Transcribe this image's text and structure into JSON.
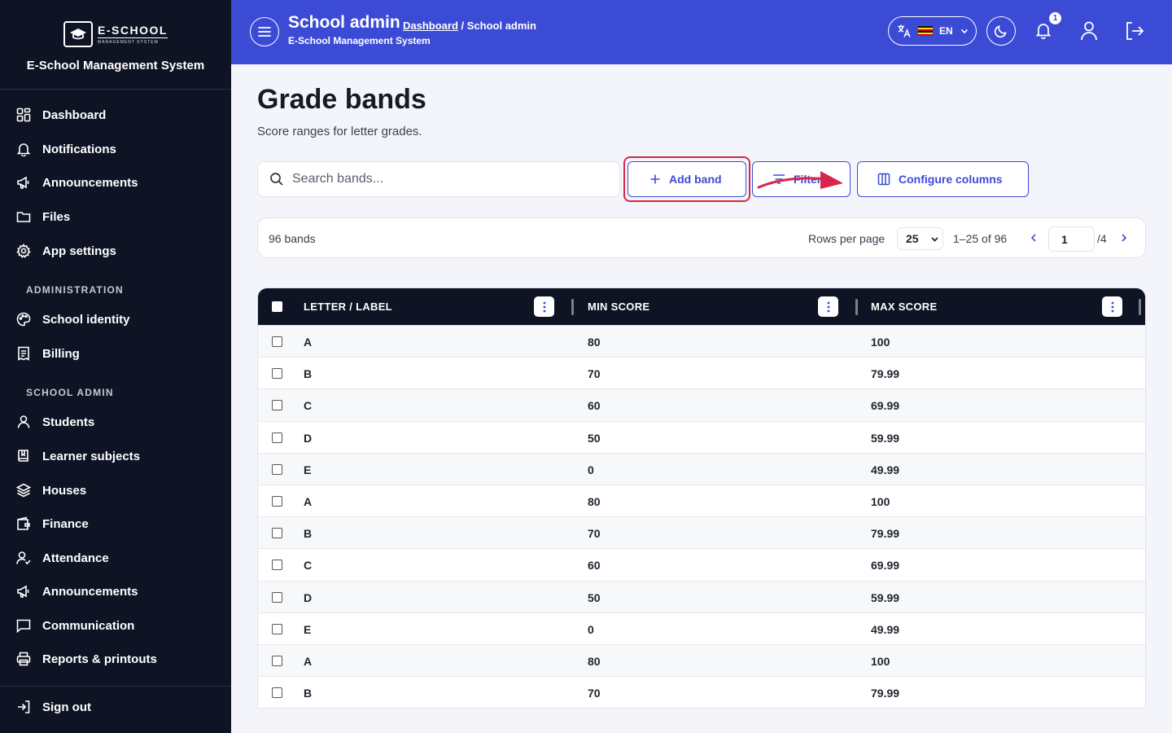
{
  "app": {
    "logo_name": "E-SCHOOL",
    "logo_sub": "MANAGEMENT SYSTEM",
    "name": "E-School Management System"
  },
  "sidebar": {
    "items": [
      {
        "label": "Dashboard",
        "icon": "grid-icon"
      },
      {
        "label": "Notifications",
        "icon": "bell-icon"
      },
      {
        "label": "Announcements",
        "icon": "megaphone-icon"
      },
      {
        "label": "Files",
        "icon": "folder-icon"
      },
      {
        "label": "App settings",
        "icon": "gear-icon"
      }
    ],
    "section_admin": "ADMINISTRATION",
    "admin_items": [
      {
        "label": "School identity",
        "icon": "palette-icon"
      },
      {
        "label": "Billing",
        "icon": "receipt-icon"
      }
    ],
    "section_school": "SCHOOL ADMIN",
    "school_items": [
      {
        "label": "Students",
        "icon": "user-icon"
      },
      {
        "label": "Learner subjects",
        "icon": "book-icon"
      },
      {
        "label": "Houses",
        "icon": "layers-icon"
      },
      {
        "label": "Finance",
        "icon": "wallet-icon"
      },
      {
        "label": "Attendance",
        "icon": "user-check-icon"
      },
      {
        "label": "Announcements",
        "icon": "megaphone-icon"
      },
      {
        "label": "Communication",
        "icon": "message-icon"
      },
      {
        "label": "Reports & printouts",
        "icon": "printer-icon"
      }
    ],
    "sign_out": "Sign out"
  },
  "topbar": {
    "title": "School admin",
    "breadcrumb_link": "Dashboard",
    "breadcrumb_current": "/ School admin",
    "subtitle": "E-School Management System",
    "lang": "EN",
    "notifications_count": "1"
  },
  "page": {
    "title": "Grade bands",
    "subtitle": "Score ranges for letter grades."
  },
  "search": {
    "placeholder": "Search bands..."
  },
  "actions": {
    "add": "Add band",
    "filter": "Filter",
    "configure": "Configure columns"
  },
  "pagination": {
    "count": "96 bands",
    "rows_label": "Rows per page",
    "rows_value": "25",
    "range": "1–25 of 96",
    "page": "1",
    "total": "/4"
  },
  "table": {
    "headers": [
      "LETTER / LABEL",
      "MIN SCORE",
      "MAX SCORE"
    ],
    "rows": [
      [
        "A",
        "80",
        "100"
      ],
      [
        "B",
        "70",
        "79.99"
      ],
      [
        "C",
        "60",
        "69.99"
      ],
      [
        "D",
        "50",
        "59.99"
      ],
      [
        "E",
        "0",
        "49.99"
      ],
      [
        "A",
        "80",
        "100"
      ],
      [
        "B",
        "70",
        "79.99"
      ],
      [
        "C",
        "60",
        "69.99"
      ],
      [
        "D",
        "50",
        "59.99"
      ],
      [
        "E",
        "0",
        "49.99"
      ],
      [
        "A",
        "80",
        "100"
      ],
      [
        "B",
        "70",
        "79.99"
      ]
    ]
  },
  "colors": {
    "topbar": "#3c4bd6",
    "sidebar": "#0f1425",
    "accent": "#3c4bd6",
    "highlight": "#d8264b"
  }
}
